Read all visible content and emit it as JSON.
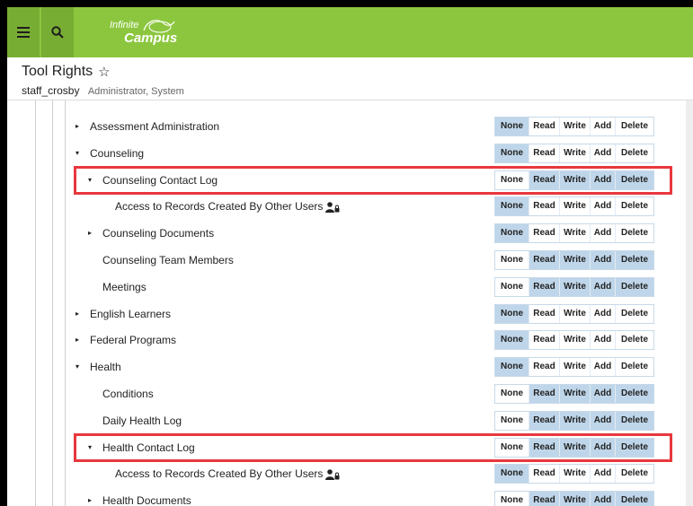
{
  "app": {
    "logo_line1": "Infinite",
    "logo_line2": "Campus"
  },
  "header": {
    "title": "Tool Rights",
    "username": "staff_crosby",
    "roles": "Administrator, System"
  },
  "right_labels": [
    "None",
    "Read",
    "Write",
    "Add",
    "Delete"
  ],
  "colors": {
    "topbar": "#8cc63f",
    "selected_right": "#bfd6ea",
    "highlight": "#e8383d"
  },
  "rows": [
    {
      "label": "Assessment Administration",
      "caret": "▸",
      "selected": [
        "None"
      ]
    },
    {
      "label": "Counseling",
      "caret": "▾",
      "selected": [
        "None"
      ]
    },
    {
      "label": "Counseling Contact Log",
      "caret": "▾",
      "selected": [
        "Read",
        "Write",
        "Add",
        "Delete"
      ],
      "highlighted": true
    },
    {
      "label": "Access to Records Created By Other Users",
      "caret": "",
      "selected": [
        "None"
      ],
      "icon": "user-lock-icon"
    },
    {
      "label": "Counseling Documents",
      "caret": "▸",
      "selected": [
        "None"
      ]
    },
    {
      "label": "Counseling Team Members",
      "caret": "",
      "selected": [
        "Read",
        "Write",
        "Add",
        "Delete"
      ]
    },
    {
      "label": "Meetings",
      "caret": "",
      "selected": [
        "Read",
        "Write",
        "Add",
        "Delete"
      ]
    },
    {
      "label": "English Learners",
      "caret": "▸",
      "selected": [
        "None"
      ]
    },
    {
      "label": "Federal Programs",
      "caret": "▸",
      "selected": [
        "None"
      ]
    },
    {
      "label": "Health",
      "caret": "▾",
      "selected": [
        "None"
      ]
    },
    {
      "label": "Conditions",
      "caret": "",
      "selected": [
        "Read",
        "Write",
        "Add",
        "Delete"
      ]
    },
    {
      "label": "Daily Health Log",
      "caret": "",
      "selected": [
        "Read",
        "Write",
        "Add",
        "Delete"
      ]
    },
    {
      "label": "Health Contact Log",
      "caret": "▾",
      "selected": [
        "Read",
        "Write",
        "Add",
        "Delete"
      ],
      "highlighted": true
    },
    {
      "label": "Access to Records Created By Other Users",
      "caret": "",
      "selected": [
        "None"
      ],
      "icon": "user-lock-icon"
    },
    {
      "label": "Health Documents",
      "caret": "▸",
      "selected": [
        "Read",
        "Write",
        "Add",
        "Delete"
      ]
    }
  ]
}
